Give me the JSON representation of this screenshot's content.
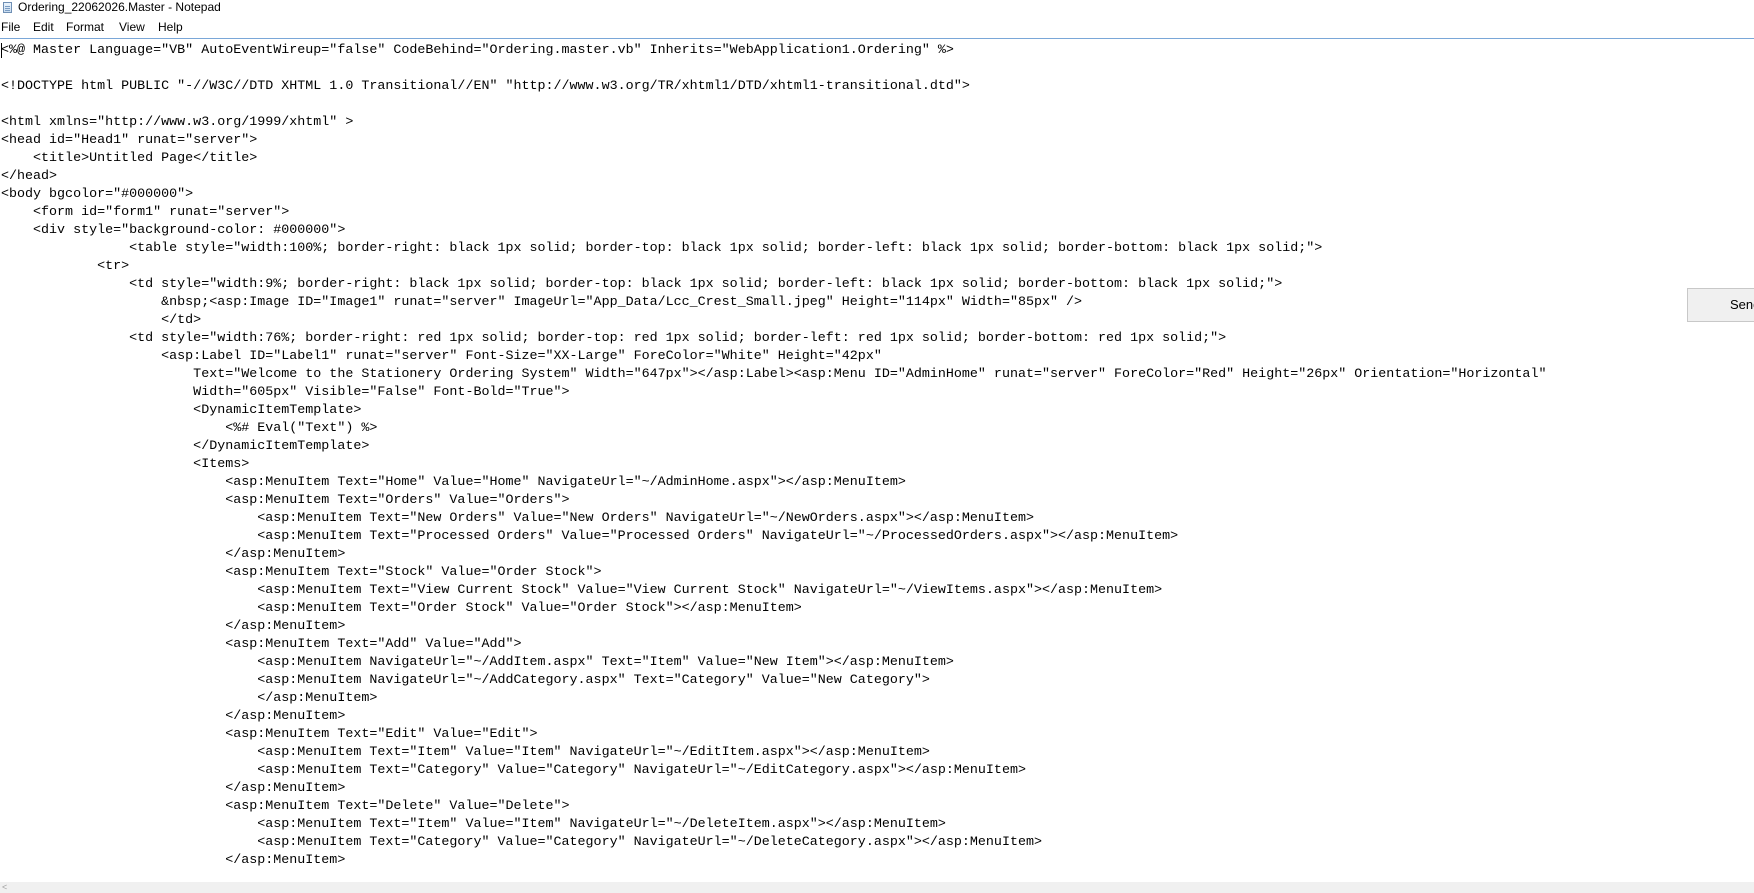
{
  "window": {
    "title": "Ordering_22062026.Master - Notepad"
  },
  "menu": {
    "items": [
      "File",
      "Edit",
      "Format",
      "View",
      "Help"
    ]
  },
  "editor": {
    "lines": [
      "<%@ Master Language=\"VB\" AutoEventWireup=\"false\" CodeBehind=\"Ordering.master.vb\" Inherits=\"WebApplication1.Ordering\" %>",
      "",
      "<!DOCTYPE html PUBLIC \"-//W3C//DTD XHTML 1.0 Transitional//EN\" \"http://www.w3.org/TR/xhtml1/DTD/xhtml1-transitional.dtd\">",
      "",
      "<html xmlns=\"http://www.w3.org/1999/xhtml\" >",
      "<head id=\"Head1\" runat=\"server\">",
      "    <title>Untitled Page</title>",
      "</head>",
      "<body bgcolor=\"#000000\">",
      "    <form id=\"form1\" runat=\"server\">",
      "    <div style=\"background-color: #000000\">",
      "                <table style=\"width:100%; border-right: black 1px solid; border-top: black 1px solid; border-left: black 1px solid; border-bottom: black 1px solid;\">",
      "            <tr>",
      "                <td style=\"width:9%; border-right: black 1px solid; border-top: black 1px solid; border-left: black 1px solid; border-bottom: black 1px solid;\">",
      "                    &nbsp;<asp:Image ID=\"Image1\" runat=\"server\" ImageUrl=\"App_Data/Lcc_Crest_Small.jpeg\" Height=\"114px\" Width=\"85px\" />",
      "                    </td>",
      "                <td style=\"width:76%; border-right: red 1px solid; border-top: red 1px solid; border-left: red 1px solid; border-bottom: red 1px solid;\">",
      "                    <asp:Label ID=\"Label1\" runat=\"server\" Font-Size=\"XX-Large\" ForeColor=\"White\" Height=\"42px\"",
      "                        Text=\"Welcome to the Stationery Ordering System\" Width=\"647px\"></asp:Label><asp:Menu ID=\"AdminHome\" runat=\"server\" ForeColor=\"Red\" Height=\"26px\" Orientation=\"Horizontal\"",
      "                        Width=\"605px\" Visible=\"False\" Font-Bold=\"True\">",
      "                        <DynamicItemTemplate>",
      "                            <%# Eval(\"Text\") %>",
      "                        </DynamicItemTemplate>",
      "                        <Items>",
      "                            <asp:MenuItem Text=\"Home\" Value=\"Home\" NavigateUrl=\"~/AdminHome.aspx\"></asp:MenuItem>",
      "                            <asp:MenuItem Text=\"Orders\" Value=\"Orders\">",
      "                                <asp:MenuItem Text=\"New Orders\" Value=\"New Orders\" NavigateUrl=\"~/NewOrders.aspx\"></asp:MenuItem>",
      "                                <asp:MenuItem Text=\"Processed Orders\" Value=\"Processed Orders\" NavigateUrl=\"~/ProcessedOrders.aspx\"></asp:MenuItem>",
      "                            </asp:MenuItem>",
      "                            <asp:MenuItem Text=\"Stock\" Value=\"Order Stock\">",
      "                                <asp:MenuItem Text=\"View Current Stock\" Value=\"View Current Stock\" NavigateUrl=\"~/ViewItems.aspx\"></asp:MenuItem>",
      "                                <asp:MenuItem Text=\"Order Stock\" Value=\"Order Stock\"></asp:MenuItem>",
      "                            </asp:MenuItem>",
      "                            <asp:MenuItem Text=\"Add\" Value=\"Add\">",
      "                                <asp:MenuItem NavigateUrl=\"~/AddItem.aspx\" Text=\"Item\" Value=\"New Item\"></asp:MenuItem>",
      "                                <asp:MenuItem NavigateUrl=\"~/AddCategory.aspx\" Text=\"Category\" Value=\"New Category\">",
      "                                </asp:MenuItem>",
      "                            </asp:MenuItem>",
      "                            <asp:MenuItem Text=\"Edit\" Value=\"Edit\">",
      "                                <asp:MenuItem Text=\"Item\" Value=\"Item\" NavigateUrl=\"~/EditItem.aspx\"></asp:MenuItem>",
      "                                <asp:MenuItem Text=\"Category\" Value=\"Category\" NavigateUrl=\"~/EditCategory.aspx\"></asp:MenuItem>",
      "                            </asp:MenuItem>",
      "                            <asp:MenuItem Text=\"Delete\" Value=\"Delete\">",
      "                                <asp:MenuItem Text=\"Item\" Value=\"Item\" NavigateUrl=\"~/DeleteItem.aspx\"></asp:MenuItem>",
      "                                <asp:MenuItem Text=\"Category\" Value=\"Category\" NavigateUrl=\"~/DeleteCategory.aspx\"></asp:MenuItem>",
      "                            </asp:MenuItem>"
    ]
  },
  "overlay": {
    "send_label": "Send"
  }
}
